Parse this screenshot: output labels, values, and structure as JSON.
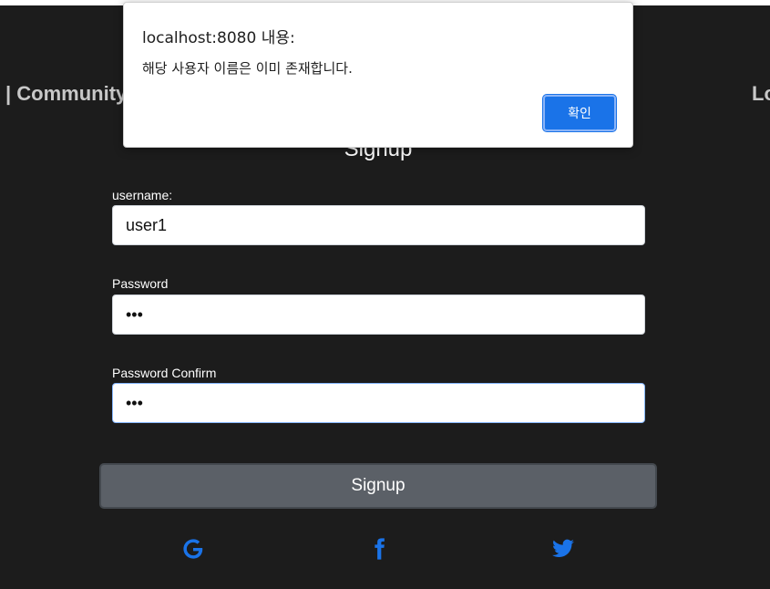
{
  "nav": {
    "left_text": "| Community",
    "right_text": "Lo"
  },
  "form": {
    "title": "Signup",
    "username_label": "username:",
    "username_value": "user1",
    "password_label": "Password",
    "password_value": "•••",
    "confirm_label": "Password Confirm",
    "confirm_value": "•••",
    "submit_label": "Signup"
  },
  "social": {
    "google": "google-icon",
    "facebook": "facebook-icon",
    "twitter": "twitter-icon",
    "icon_color": "#1a73e8"
  },
  "dialog": {
    "title": "localhost:8080 내용:",
    "message": "해당 사용자 이름은 이미 존재합니다.",
    "ok_label": "확인",
    "ok_color": "#1a73e8"
  }
}
